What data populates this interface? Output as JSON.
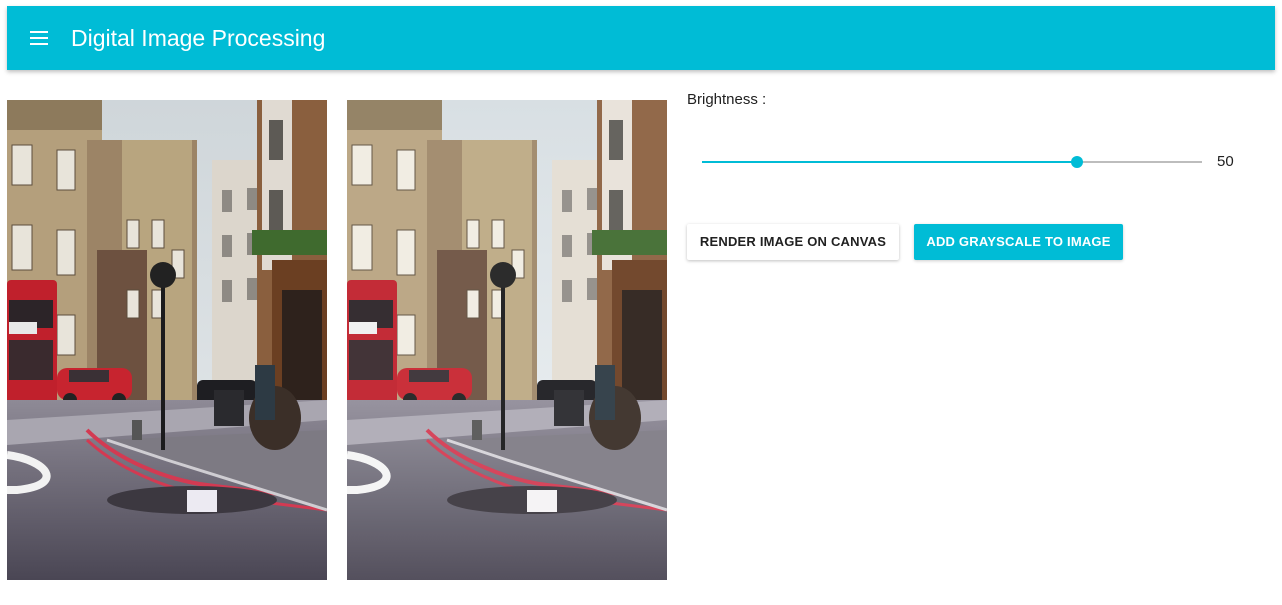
{
  "app": {
    "title": "Digital Image Processing",
    "menu_icon": "hamburger-menu-icon",
    "accent_color": "#00bcd6"
  },
  "images": {
    "original": {
      "description_icon": "street-photo"
    },
    "canvas": {
      "description_icon": "street-photo-processed"
    }
  },
  "controls": {
    "brightness_label": "Brightness :",
    "brightness_value": "50",
    "brightness_fraction": 0.75,
    "render_button_label": "RENDER IMAGE ON CANVAS",
    "grayscale_button_label": "ADD GRAYSCALE TO IMAGE"
  }
}
